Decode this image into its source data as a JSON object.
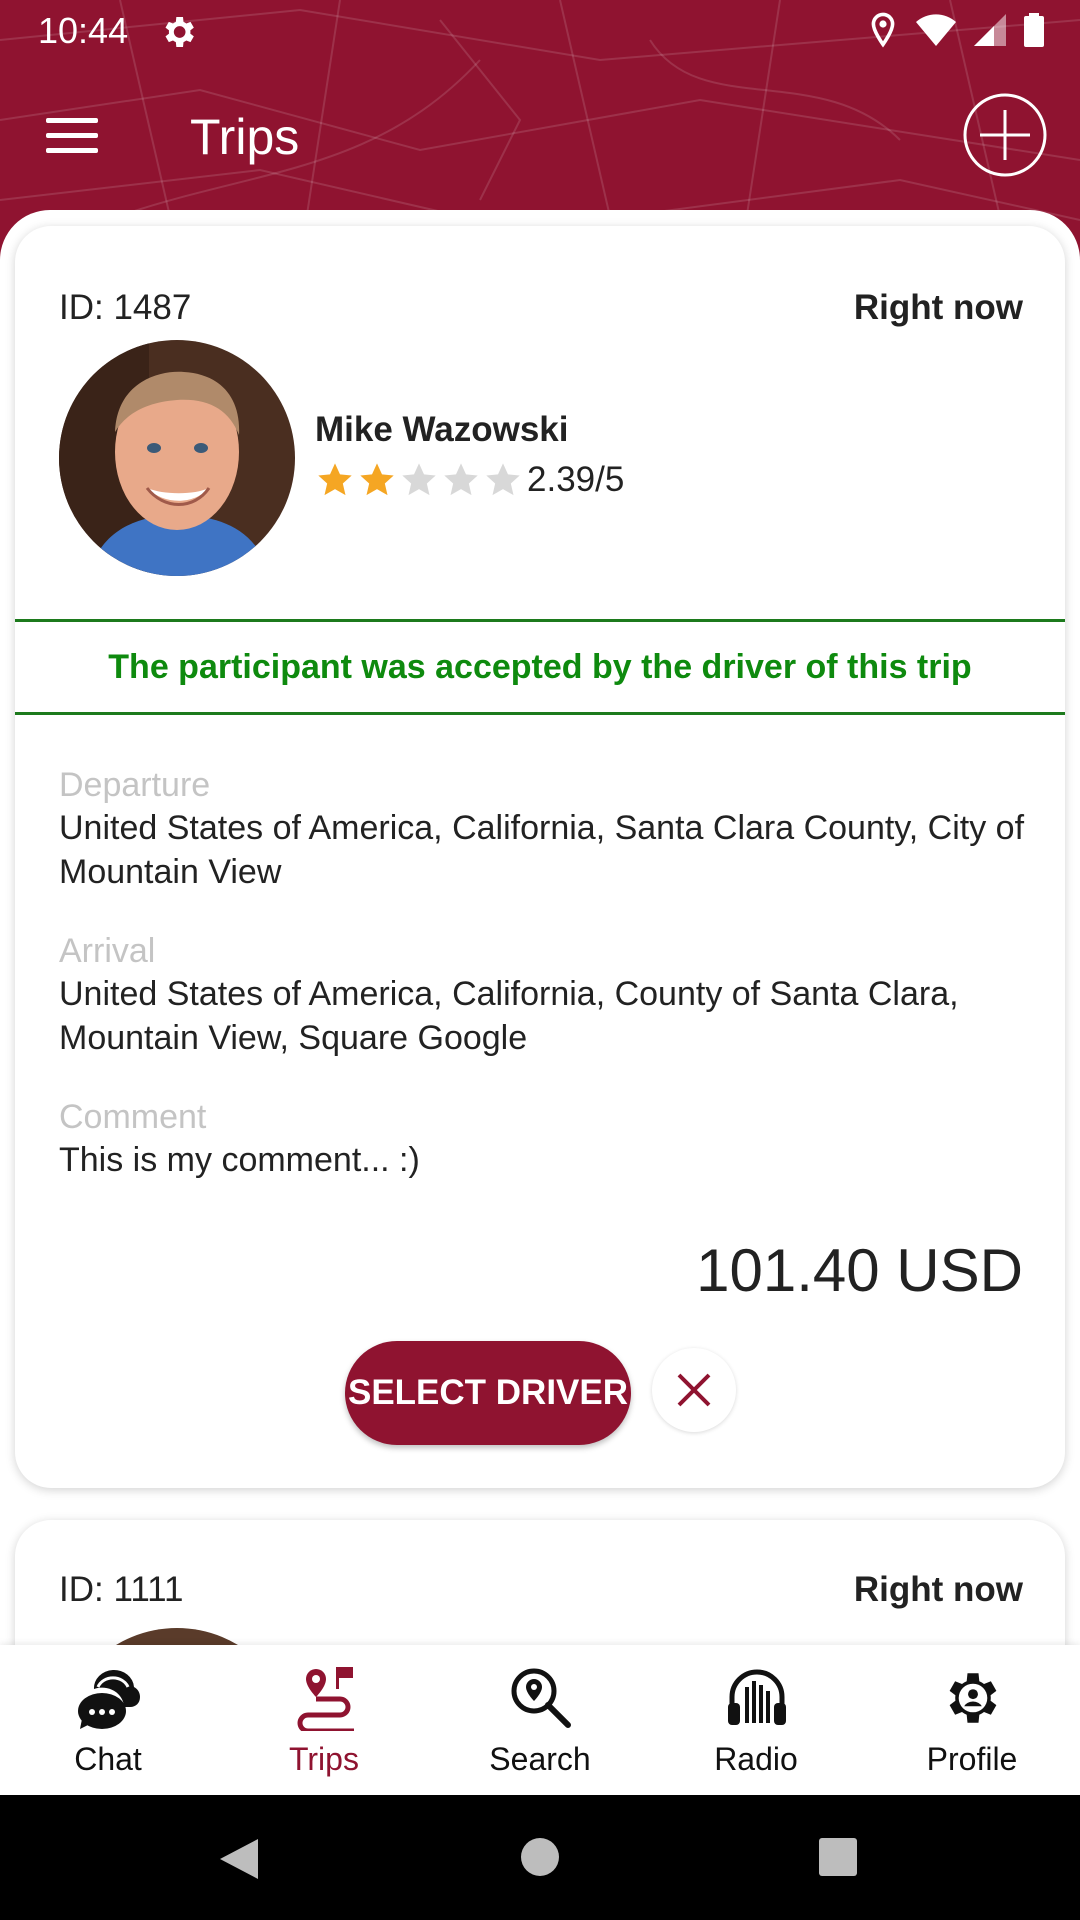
{
  "status_bar": {
    "time": "10:44"
  },
  "header": {
    "title": "Trips"
  },
  "colors": {
    "brand": "#8f1330",
    "accepted": "#0e8a0e",
    "star_filled": "#f5a623",
    "star_empty": "#d8d8d8"
  },
  "trips": [
    {
      "id_text": "ID: 1487",
      "time": "Right now",
      "driver_name": "Mike Wazowski",
      "rating_value": 2.39,
      "rating_text": "2.39/5",
      "status_text": "The participant was accepted by the driver of this trip",
      "departure_label": "Departure",
      "departure_value": "United States of America, California, Santa Clara County, City of Mountain View",
      "arrival_label": "Arrival",
      "arrival_value": "United States of America, California, County of Santa Clara, Mountain View, Square Google",
      "comment_label": "Comment",
      "comment_value": "This is my comment... :)",
      "price": "101.40 USD",
      "select_button": "SELECT DRIVER"
    },
    {
      "id_text": "ID: 1111",
      "time": "Right now"
    }
  ],
  "bottom_nav": [
    {
      "label": "Chat",
      "icon": "chat-icon"
    },
    {
      "label": "Trips",
      "icon": "trips-icon",
      "active": true
    },
    {
      "label": "Search",
      "icon": "search-icon"
    },
    {
      "label": "Radio",
      "icon": "radio-icon"
    },
    {
      "label": "Profile",
      "icon": "profile-icon"
    }
  ]
}
